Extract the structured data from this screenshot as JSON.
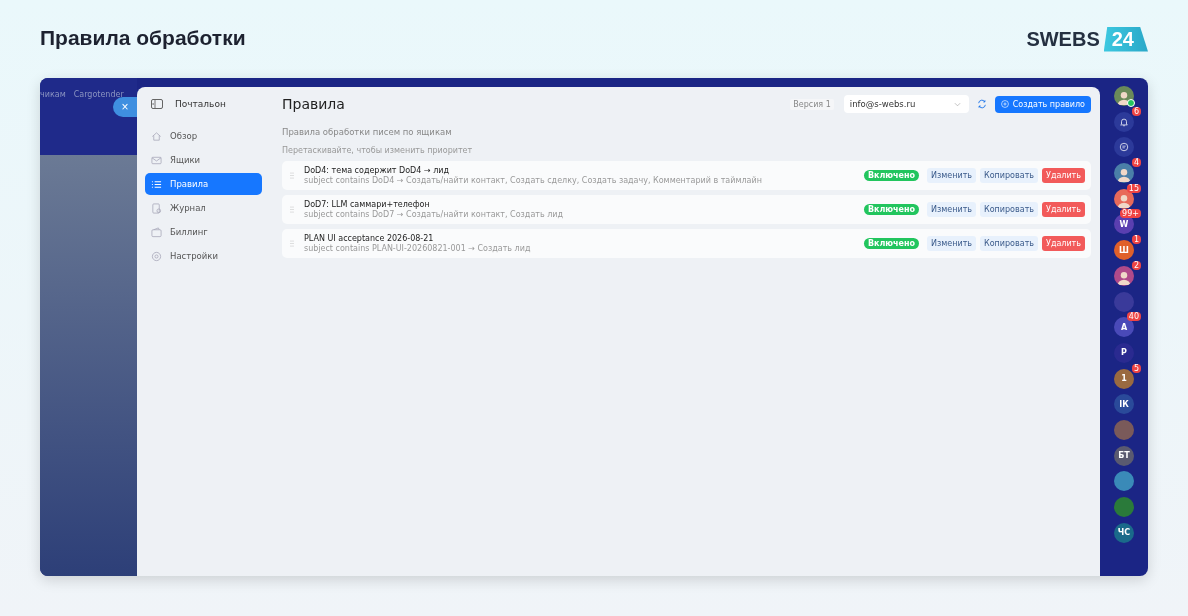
{
  "page_title": "Правила обработки",
  "logo": {
    "word": "SWEBS",
    "number": "24"
  },
  "background_tabs": [
    "чикам",
    "Cargotender"
  ],
  "close_button": {
    "label": "×"
  },
  "app": {
    "name": "Почтальон"
  },
  "sidebar": {
    "items": [
      {
        "label": "Обзор",
        "selected": false
      },
      {
        "label": "Ящики",
        "selected": false
      },
      {
        "label": "Правила",
        "selected": true
      },
      {
        "label": "Журнал",
        "selected": false
      },
      {
        "label": "Биллинг",
        "selected": false
      },
      {
        "label": "Настройки",
        "selected": false
      }
    ]
  },
  "header": {
    "title": "Правила",
    "version": "Версия 1",
    "mailbox": {
      "value": "info@s-webs.ru"
    },
    "create_button": "Создать правило"
  },
  "subtitle": "Правила обработки писем по ящикам",
  "hint": "Перетаскивайте, чтобы изменить приоритет",
  "rules": [
    {
      "title": "DoD4: тема содержит DoD4 → лид",
      "description": "subject contains DoD4 → Создать/найти контакт, Создать сделку, Создать задачу, Комментарий в таймлайн",
      "status": "Включено",
      "enabled": true,
      "actions": [
        "Изменить",
        "Копировать",
        "Удалить"
      ]
    },
    {
      "title": "DoD7: LLM саммари+телефон",
      "description": "subject contains DoD7 → Создать/найти контакт, Создать лид",
      "status": "Включено",
      "enabled": true,
      "actions": [
        "Изменить",
        "Копировать",
        "Удалить"
      ]
    },
    {
      "title": "PLAN UI acceptance 2026-08-21",
      "description": "subject contains PLAN-UI-20260821-001 → Создать лид",
      "status": "Включено",
      "enabled": true,
      "actions": [
        "Изменить",
        "Копировать",
        "Удалить"
      ]
    }
  ],
  "rail": [
    {
      "kind": "avatar",
      "color": "#6a8a5a",
      "online": true
    },
    {
      "kind": "bell",
      "badge": "6"
    },
    {
      "kind": "chat"
    },
    {
      "kind": "avatar",
      "color": "#4a7fa8",
      "badge": "4"
    },
    {
      "kind": "avatar",
      "color": "#e86a5a",
      "badge": "15"
    },
    {
      "kind": "letter",
      "letter": "W",
      "color": "#5a3fb0",
      "badge": "99+"
    },
    {
      "kind": "letter",
      "letter": "Ш",
      "color": "#e0602a",
      "badge": "1"
    },
    {
      "kind": "avatar",
      "color": "#b04a8a",
      "badge": "2"
    },
    {
      "kind": "letter",
      "color": "#3a3a9a"
    },
    {
      "kind": "letter",
      "letter": "A",
      "color": "#4a4ab8",
      "badge": "40"
    },
    {
      "kind": "letter",
      "letter": "Р",
      "color": "#2a2a90"
    },
    {
      "kind": "letter",
      "letter": "1",
      "color": "#9a6a40",
      "badge": "5"
    },
    {
      "kind": "letter",
      "letter": "ІК",
      "color": "#2a4a9a"
    },
    {
      "kind": "letter",
      "color": "#7a5a5a"
    },
    {
      "kind": "letter",
      "letter": "БТ",
      "color": "#5a5a70"
    },
    {
      "kind": "letter",
      "color": "#3a8ab8"
    },
    {
      "kind": "letter",
      "color": "#2a7a3a"
    },
    {
      "kind": "letter",
      "letter": "ЧС",
      "color": "#1a6a8a"
    }
  ]
}
